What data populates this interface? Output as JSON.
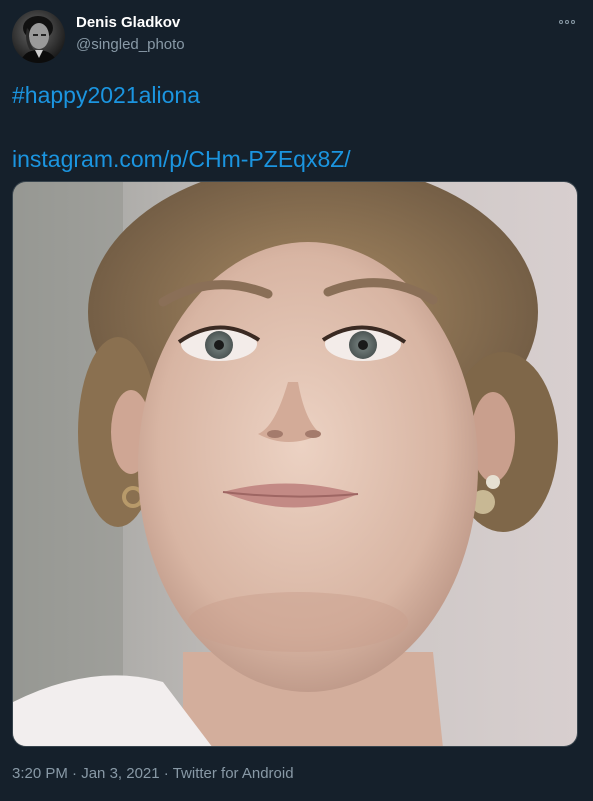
{
  "author": {
    "display_name": "Denis Gladkov",
    "username": "@singled_photo"
  },
  "tweet": {
    "hashtag": "#happy2021aliona",
    "link": "instagram.com/p/CHm-PZEqx8Z/",
    "time": "3:20 PM",
    "separator1": " · ",
    "date": "Jan 3, 2021",
    "separator2": " · ",
    "source": "Twitter for Android"
  },
  "icons": {
    "more": "more-options-icon"
  },
  "colors": {
    "background": "#15202b",
    "link": "#1b95e0",
    "secondary_text": "#8899a6",
    "primary_text": "#ffffff"
  }
}
